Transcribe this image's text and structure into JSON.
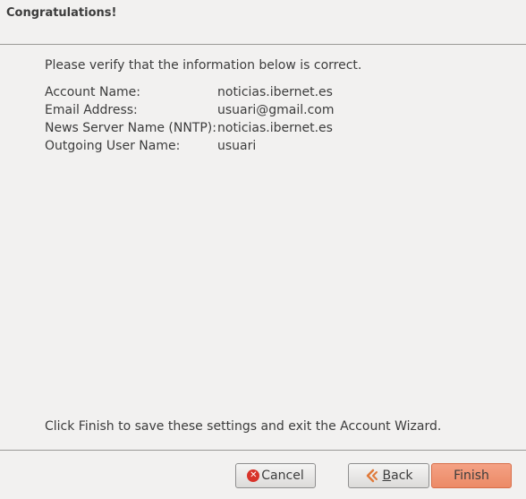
{
  "header": {
    "title": "Congratulations!"
  },
  "content": {
    "intro": "Please verify that the information below is correct.",
    "rows": [
      {
        "label": "Account Name:",
        "value": "noticias.ibernet.es"
      },
      {
        "label": "Email Address:",
        "value": "usuari@gmail.com"
      },
      {
        "label": "News Server Name (NNTP):",
        "value": "noticias.ibernet.es"
      },
      {
        "label": "Outgoing User Name:",
        "value": "usuari"
      }
    ]
  },
  "footer": {
    "text": "Click Finish to save these settings and exit the Account Wizard."
  },
  "buttons": {
    "cancel": {
      "label": "Cancel",
      "icon": "cancel-icon"
    },
    "back": {
      "label_accel": "B",
      "label_rest": "ack",
      "icon": "back-arrow-icon"
    },
    "finish": {
      "label": "Finish"
    }
  }
}
